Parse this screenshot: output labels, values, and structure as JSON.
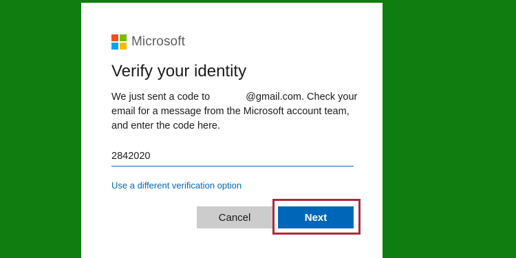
{
  "brand": {
    "name": "Microsoft",
    "logo_colors": {
      "red": "#f25022",
      "green": "#7fba00",
      "blue": "#00a4ef",
      "yellow": "#ffb900"
    }
  },
  "dialog": {
    "title": "Verify your identity",
    "message_part1": "We just sent a code to",
    "message_part2": "@gmail.com. Check your email for a message from the Microsoft account team, and enter the code here.",
    "code_value": "2842020",
    "alt_option_link": "Use a different verification option",
    "cancel_label": "Cancel",
    "next_label": "Next"
  },
  "colors": {
    "background": "#0f7d0f",
    "accent": "#0067b8",
    "highlight_box": "#b0283a"
  }
}
